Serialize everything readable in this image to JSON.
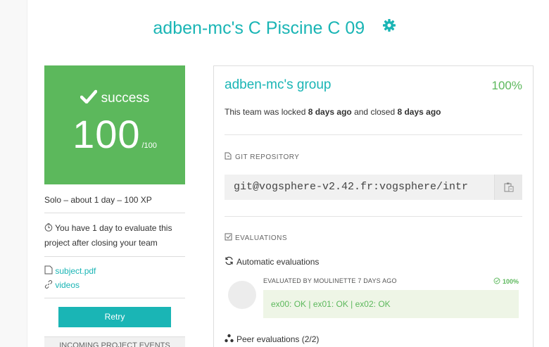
{
  "page": {
    "title": "adben-mc's C Piscine C 09"
  },
  "summary": {
    "status_label": "success",
    "score": "100",
    "score_max": "/100",
    "meta": "Solo – about 1 day – 100 XP",
    "evaluate_notice": "You have 1 day to evaluate this project after closing your team",
    "subject_link": "subject.pdf",
    "videos_link": "videos",
    "retry_label": "Retry",
    "events_label": "INCOMING PROJECT EVENTS"
  },
  "group": {
    "name": "adben-mc's group",
    "percent": "100%",
    "locked_prefix": "This team was locked ",
    "locked_when": "8 days ago",
    "closed_prefix": " and closed ",
    "closed_when": "8 days ago"
  },
  "git": {
    "label": "GIT REPOSITORY",
    "url": "git@vogsphere-v2.42.fr:vogsphere/intr"
  },
  "evaluations": {
    "label": "EVALUATIONS",
    "automatic_label": "Automatic evaluations",
    "evaluated_by": "EVALUATED BY MOULINETTE 7 DAYS AGO",
    "percent": "100%",
    "result": "ex00: OK | ex01: OK | ex02: OK",
    "peer_label": "Peer evaluations (2/2)"
  },
  "colors": {
    "accent": "#1ab5b5",
    "success": "#5cb85c"
  },
  "icons": [
    "gear-icon",
    "checkmark-icon",
    "clock-icon",
    "document-icon",
    "link-icon",
    "git-icon",
    "clipboard-icon",
    "checklist-icon",
    "refresh-icon",
    "peers-icon",
    "check-circle-icon"
  ]
}
